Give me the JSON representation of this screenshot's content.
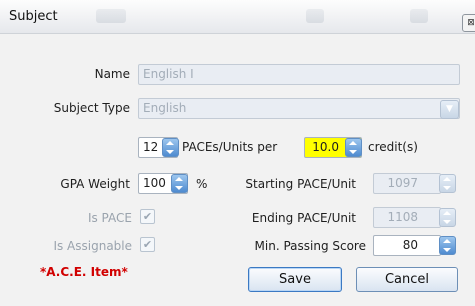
{
  "window": {
    "title": "Subject",
    "close_glyph": "⊠"
  },
  "form": {
    "name": {
      "label": "Name",
      "value": "English I"
    },
    "subject_type": {
      "label": "Subject Type",
      "value": "English"
    },
    "paces": {
      "count": "12",
      "text_per": "PACEs/Units per",
      "credit_value": "10.0",
      "text_credit": "credit(s)"
    },
    "gpa_weight": {
      "label": "GPA Weight",
      "value": "100",
      "unit": "%"
    },
    "starting_pace": {
      "label": "Starting PACE/Unit",
      "value": "1097"
    },
    "ending_pace": {
      "label": "Ending PACE/Unit",
      "value": "1108"
    },
    "is_pace": {
      "label": "Is PACE",
      "checked": true
    },
    "is_assignable": {
      "label": "Is Assignable",
      "checked": true
    },
    "min_passing": {
      "label": "Min. Passing Score",
      "value": "80"
    },
    "ace_item": "*A.C.E. Item*"
  },
  "buttons": {
    "save": "Save",
    "cancel": "Cancel"
  },
  "colors": {
    "accent": "#4f8bd0",
    "highlight": "#ffff00",
    "ace_red": "#d10000"
  }
}
